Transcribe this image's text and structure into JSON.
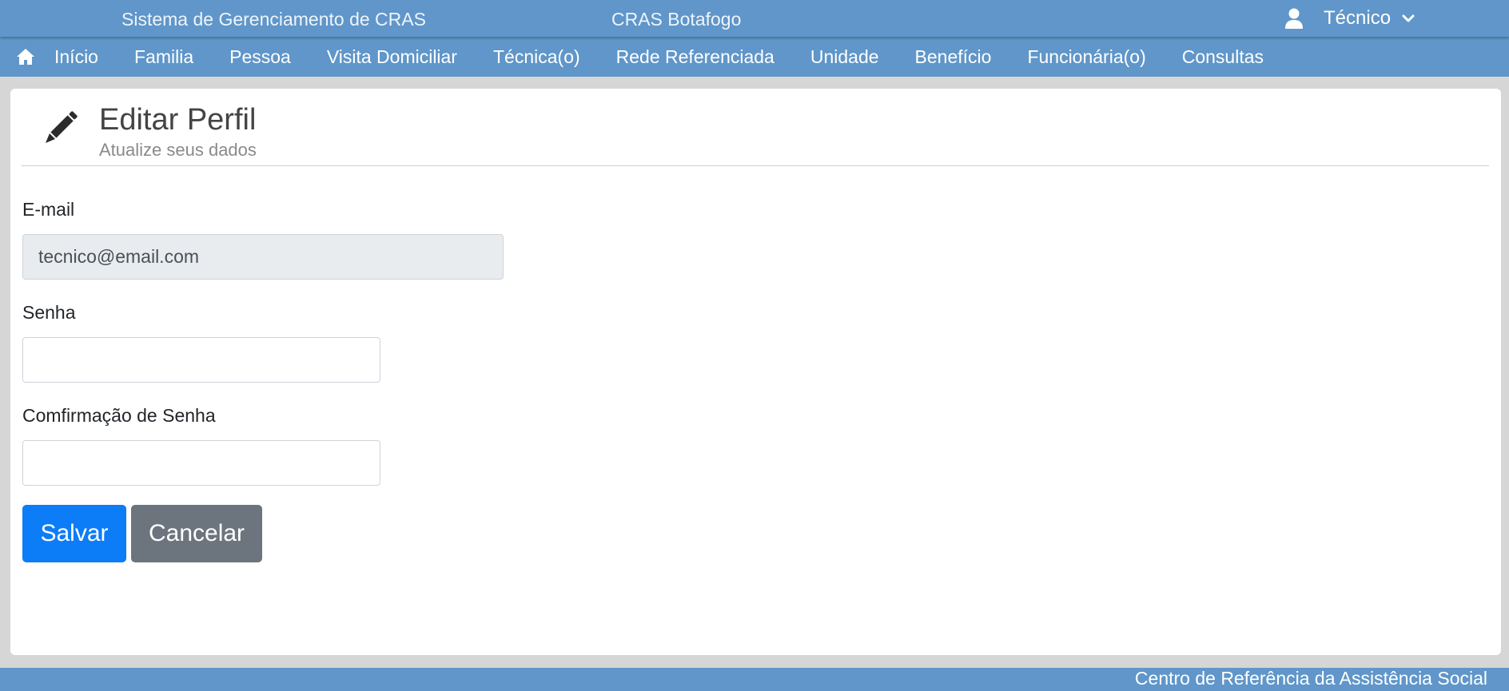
{
  "header": {
    "system_title": "Sistema de Gerenciamento de CRAS",
    "unit_title": "CRAS Botafogo",
    "user_name": "Técnico"
  },
  "nav": {
    "items": [
      "Início",
      "Familia",
      "Pessoa",
      "Visita Domiciliar",
      "Técnica(o)",
      "Rede Referenciada",
      "Unidade",
      "Benefício",
      "Funcionária(o)",
      "Consultas"
    ]
  },
  "page": {
    "title": "Editar Perfil",
    "subtitle": "Atualize seus dados"
  },
  "form": {
    "email_label": "E-mail",
    "email_value": "tecnico@email.com",
    "password_label": "Senha",
    "password_value": "",
    "confirm_label": "Comfirmação de Senha",
    "confirm_value": "",
    "save_label": "Salvar",
    "cancel_label": "Cancelar"
  },
  "footer": {
    "text": "Centro de Referência da Assistência Social"
  },
  "icons": {
    "home": "home-icon",
    "user": "user-icon",
    "chevron": "chevron-down-icon",
    "page": "pencil-icon"
  },
  "colors": {
    "bar": "#6096c9",
    "primary": "#0d7cf7",
    "secondary": "#6c757d"
  }
}
